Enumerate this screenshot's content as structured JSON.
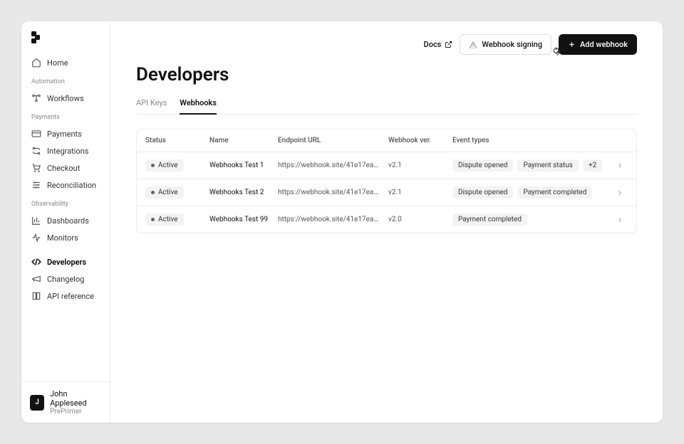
{
  "sidebar": {
    "home": "Home",
    "sections": [
      {
        "title": "Automation",
        "items": [
          {
            "icon": "workflows",
            "label": "Workflows"
          }
        ]
      },
      {
        "title": "Payments",
        "items": [
          {
            "icon": "card",
            "label": "Payments"
          },
          {
            "icon": "integrations",
            "label": "Integrations"
          },
          {
            "icon": "cart",
            "label": "Checkout"
          },
          {
            "icon": "sliders",
            "label": "Reconciliation"
          }
        ]
      },
      {
        "title": "Observability",
        "items": [
          {
            "icon": "chart",
            "label": "Dashboards"
          },
          {
            "icon": "pulse",
            "label": "Monitors"
          }
        ]
      },
      {
        "title": "",
        "items": [
          {
            "icon": "code",
            "label": "Developers",
            "active": true
          },
          {
            "icon": "announce",
            "label": "Changelog"
          },
          {
            "icon": "book",
            "label": "API reference"
          }
        ]
      }
    ]
  },
  "user": {
    "initial": "J",
    "name": "John Appleseed",
    "org": "PrePrimer"
  },
  "topbar": {
    "docs": "Docs",
    "signing": "Webhook signing",
    "add": "Add webhook"
  },
  "page": {
    "title": "Developers"
  },
  "tabs": [
    {
      "label": "API Keys"
    },
    {
      "label": "Webhooks",
      "active": true
    }
  ],
  "table": {
    "headers": {
      "status": "Status",
      "name": "Name",
      "url": "Endpoint URL",
      "ver": "Webhook ver.",
      "events": "Event types"
    },
    "rows": [
      {
        "status": "Active",
        "name": "Webhooks Test 1",
        "url": "https://webhook.site/41e17ea4-a...",
        "ver": "v2.1",
        "events": [
          "Dispute opened",
          "Payment status",
          "+2"
        ]
      },
      {
        "status": "Active",
        "name": "Webhooks Test 2",
        "url": "https://webhook.site/41e17ea4-a...",
        "ver": "v2.1",
        "events": [
          "Dispute opened",
          "Payment completed"
        ]
      },
      {
        "status": "Active",
        "name": "Webhooks Test 99",
        "url": "https://webhook.site/41e17ea4-a...",
        "ver": "v2.0",
        "events": [
          "Payment completed"
        ]
      }
    ]
  }
}
